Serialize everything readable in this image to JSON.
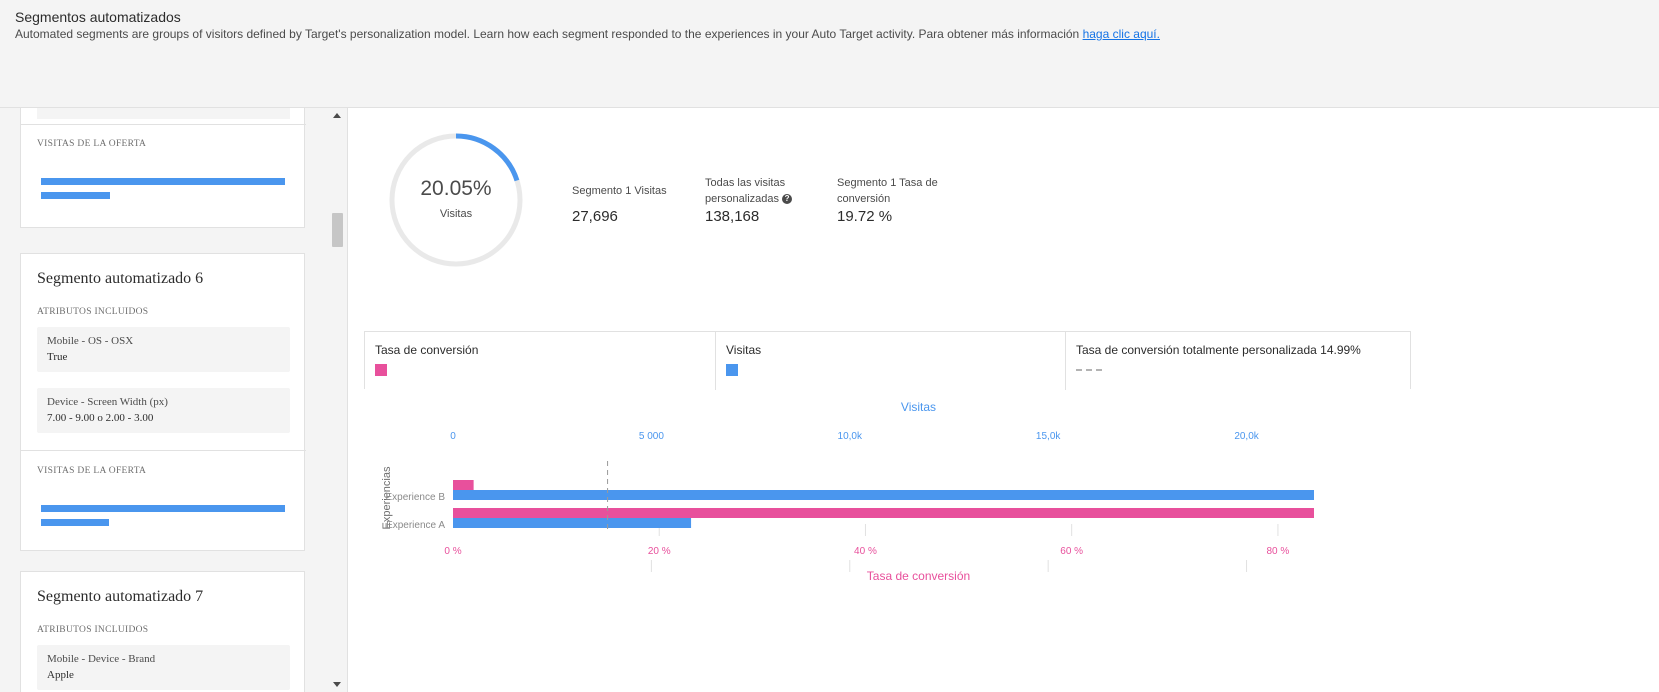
{
  "header": {
    "title": "Segmentos automatizados",
    "description": "Automated segments are groups of visitors defined by Target's personalization model. Learn how each segment responded to the experiences in your Auto Target activity. Para obtener más información",
    "link": "haga clic aquí."
  },
  "left_panel": {
    "card_top": {
      "offer_visits_label": "VISITAS DE LA OFERTA"
    },
    "segment6": {
      "title": "Segmento automatizado 6",
      "attributes_label": "ATRIBUTOS INCLUIDOS",
      "attributes": [
        {
          "name": "Mobile - OS - OSX",
          "value": "True"
        },
        {
          "name": "Device - Screen Width (px)",
          "value": "7.00 - 9.00 o 2.00 - 3.00"
        }
      ],
      "offer_visits_label": "VISITAS DE LA OFERTA"
    },
    "segment7": {
      "title": "Segmento automatizado 7",
      "attributes_label": "ATRIBUTOS INCLUIDOS",
      "attributes": [
        {
          "name": "Mobile - Device - Brand",
          "value": "Apple"
        }
      ]
    }
  },
  "summary": {
    "donut_percent": "20.05%",
    "donut_fraction": 0.2005,
    "donut_label": "Visitas",
    "stats": [
      {
        "label": "Segmento 1 Visitas",
        "value": "27,696"
      },
      {
        "label": "Todas las visitas personalizadas",
        "value": "138,168"
      },
      {
        "label": "Segmento 1 Tasa de conversión",
        "value": "19.72 %"
      }
    ]
  },
  "legend": {
    "conversion": "Tasa de conversión",
    "visits": "Visitas",
    "full_personalized": "Tasa de conversión totalmente personalizada 14.99%"
  },
  "colors": {
    "pink": "#e8509c",
    "blue": "#4a96ee",
    "grey": "#b3b3b3"
  },
  "chart_data": {
    "type": "bar",
    "orientation": "horizontal",
    "categories": [
      "Experience B",
      "Experience A"
    ],
    "ylabel": "Experiencias",
    "top_axis": {
      "label": "Visitas",
      "ticks": [
        0,
        5000,
        10000,
        15000,
        20000
      ],
      "tick_labels": [
        "0",
        "5 000",
        "10,0k",
        "15,0k",
        "20,0k"
      ],
      "range": [
        0,
        21700
      ]
    },
    "bottom_axis": {
      "label": "Tasa de conversión",
      "ticks": [
        0,
        20,
        40,
        60,
        80
      ],
      "tick_labels": [
        "0 %",
        "20 %",
        "40 %",
        "60 %",
        "80 %"
      ],
      "range": [
        0,
        83.5
      ]
    },
    "series": [
      {
        "name": "Tasa de conversión",
        "axis": "bottom",
        "values": [
          2,
          83.5
        ]
      },
      {
        "name": "Visitas",
        "axis": "top",
        "values": [
          21700,
          6000
        ]
      }
    ],
    "reference_line": {
      "name": "Tasa de conversión totalmente personalizada",
      "value": 14.99,
      "axis": "bottom"
    }
  }
}
